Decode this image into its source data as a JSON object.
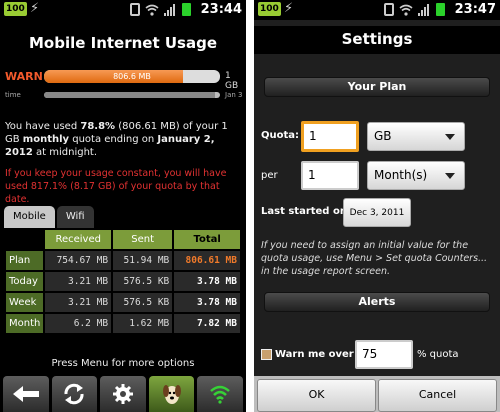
{
  "status_left": {
    "battery_level": "100",
    "clock": "23:44"
  },
  "status_right": {
    "battery_level": "100",
    "clock": "23:47"
  },
  "usage_screen": {
    "title": "Mobile Internet Usage",
    "warn_label": "WARN",
    "usage_bar_text": "806.6 MB",
    "usage_fraction": 0.788,
    "quota_label": "1 GB",
    "time_label": "time",
    "time_fraction": 0.97,
    "end_label": "Jan 3",
    "summary": {
      "part1": "You have used ",
      "percent": "78.8%",
      "part2": " (806.61 MB) of your 1 GB ",
      "period": "monthly",
      "part3": " quota ending on ",
      "end_date": "January 2, 2012",
      "part4": " at midnight."
    },
    "projection": "If you keep your usage constant, you will have used 817.1% (8.17 GB) of your quota by that date.",
    "tabs": [
      "Mobile",
      "Wifi"
    ],
    "table": {
      "headers": [
        "Received",
        "Sent",
        "Total"
      ],
      "rows": [
        {
          "label": "Plan",
          "received": "754.67 MB",
          "sent": "51.94 MB",
          "total": "806.61 MB"
        },
        {
          "label": "Today",
          "received": "3.21 MB",
          "sent": "576.5 KB",
          "total": "3.78 MB"
        },
        {
          "label": "Week",
          "received": "3.21 MB",
          "sent": "576.5 KB",
          "total": "3.78 MB"
        },
        {
          "label": "Month",
          "received": "6.2 MB",
          "sent": "1.62 MB",
          "total": "7.82 MB"
        }
      ]
    },
    "footer_hint": "Press Menu for more options",
    "nav_icons": [
      "back-arrow-icon",
      "refresh-icon",
      "gear-icon",
      "dog-icon",
      "wifi-signal-icon"
    ]
  },
  "settings_screen": {
    "title": "Settings",
    "your_plan_header": "Your Plan",
    "quota_label": "Quota:",
    "quota_value": "1",
    "quota_unit": "GB",
    "per_label": "per",
    "per_value": "1",
    "per_unit": "Month(s)",
    "last_started_label": "Last started on",
    "last_started_value": "Dec 3, 2011",
    "info_text": "If you need to assign an initial value for the quota usage, use Menu > Set quota Counters... in the usage report screen.",
    "alerts_header": "Alerts",
    "warn_me_label": "Warn me over",
    "warn_value": "75",
    "warn_suffix": "% quota",
    "ok_label": "OK",
    "cancel_label": "Cancel"
  },
  "colors": {
    "warn": "#f35a2c",
    "projection": "#e23232",
    "table_header": "#7c9c3a",
    "row_header": "#4d6b26",
    "highlight_total": "#f07a2a",
    "focus_border": "#f0a020"
  }
}
